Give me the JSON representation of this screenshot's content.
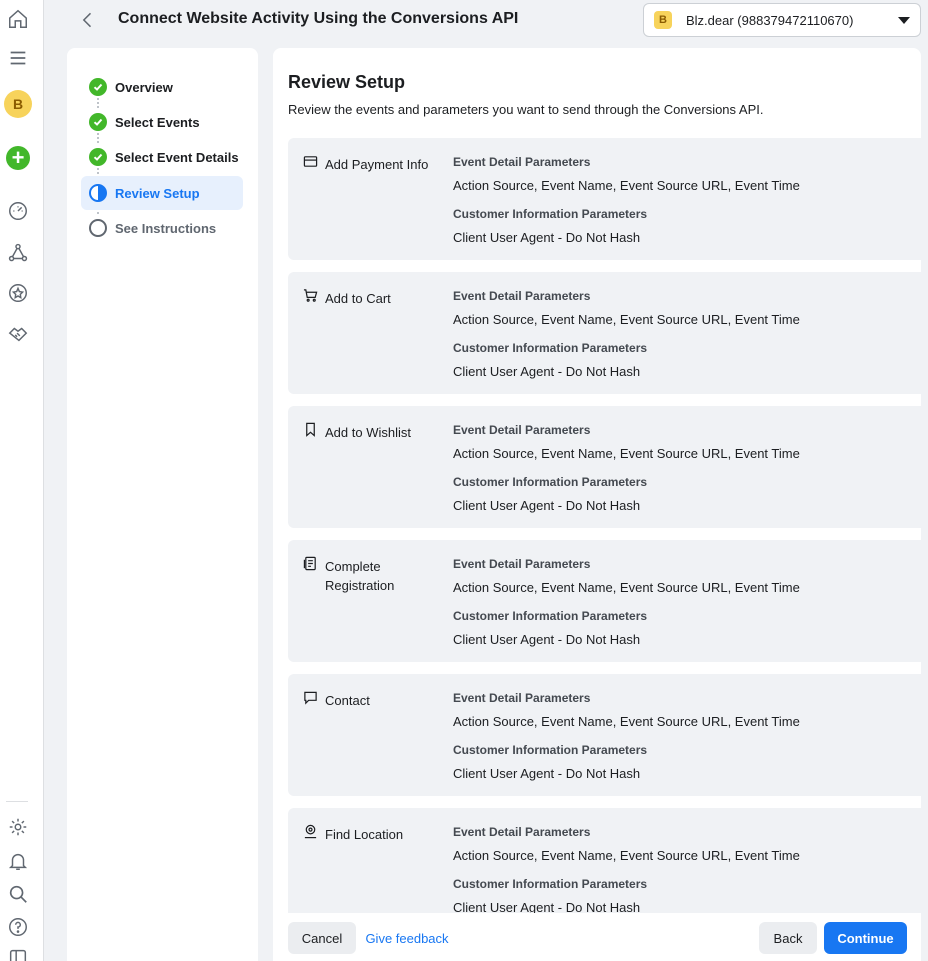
{
  "header": {
    "title": "Connect Website Activity Using the Conversions API",
    "account": {
      "badge": "B",
      "name": "Blz.dear (988379472110670)"
    }
  },
  "rail": {
    "avatar_letter": "B",
    "icons": [
      "home-icon",
      "menu-icon",
      "avatar",
      "add-icon",
      "dashboard-icon",
      "network-icon",
      "star-icon",
      "handshake-icon",
      "settings-icon",
      "notifications-icon",
      "search-icon",
      "help-icon",
      "panel-icon"
    ]
  },
  "steps": [
    {
      "label": "Overview",
      "state": "done"
    },
    {
      "label": "Select Events",
      "state": "done"
    },
    {
      "label": "Select Event Details",
      "state": "done"
    },
    {
      "label": "Review Setup",
      "state": "active"
    },
    {
      "label": "See Instructions",
      "state": "todo"
    }
  ],
  "review": {
    "title": "Review Setup",
    "description": "Review the events and parameters you want to send through the Conversions API."
  },
  "events": [
    {
      "name": "Add Payment Info",
      "icon": "card-icon",
      "event_detail_heading": "Event Detail Parameters",
      "event_detail_values": "Action Source, Event Name, Event Source URL, Event Time",
      "customer_info_heading": "Customer Information Parameters",
      "customer_info_values": "Client User Agent - Do Not Hash"
    },
    {
      "name": "Add to Cart",
      "icon": "cart-icon",
      "event_detail_heading": "Event Detail Parameters",
      "event_detail_values": "Action Source, Event Name, Event Source URL, Event Time",
      "customer_info_heading": "Customer Information Parameters",
      "customer_info_values": "Client User Agent - Do Not Hash"
    },
    {
      "name": "Add to Wishlist",
      "icon": "bookmark-icon",
      "event_detail_heading": "Event Detail Parameters",
      "event_detail_values": "Action Source, Event Name, Event Source URL, Event Time",
      "customer_info_heading": "Customer Information Parameters",
      "customer_info_values": "Client User Agent - Do Not Hash"
    },
    {
      "name": "Complete Registration",
      "icon": "registration-icon",
      "event_detail_heading": "Event Detail Parameters",
      "event_detail_values": "Action Source, Event Name, Event Source URL, Event Time",
      "customer_info_heading": "Customer Information Parameters",
      "customer_info_values": "Client User Agent - Do Not Hash"
    },
    {
      "name": "Contact",
      "icon": "chat-icon",
      "event_detail_heading": "Event Detail Parameters",
      "event_detail_values": "Action Source, Event Name, Event Source URL, Event Time",
      "customer_info_heading": "Customer Information Parameters",
      "customer_info_values": "Client User Agent - Do Not Hash"
    },
    {
      "name": "Find Location",
      "icon": "location-icon",
      "event_detail_heading": "Event Detail Parameters",
      "event_detail_values": "Action Source, Event Name, Event Source URL, Event Time",
      "customer_info_heading": "Customer Information Parameters",
      "customer_info_values": "Client User Agent - Do Not Hash"
    }
  ],
  "footer": {
    "cancel_label": "Cancel",
    "feedback_label": "Give feedback",
    "back_label": "Back",
    "continue_label": "Continue"
  },
  "colors": {
    "accent": "#1877f2",
    "success": "#42b72a",
    "card_bg": "#f0f2f5",
    "account_badge": "#f7d35b"
  }
}
